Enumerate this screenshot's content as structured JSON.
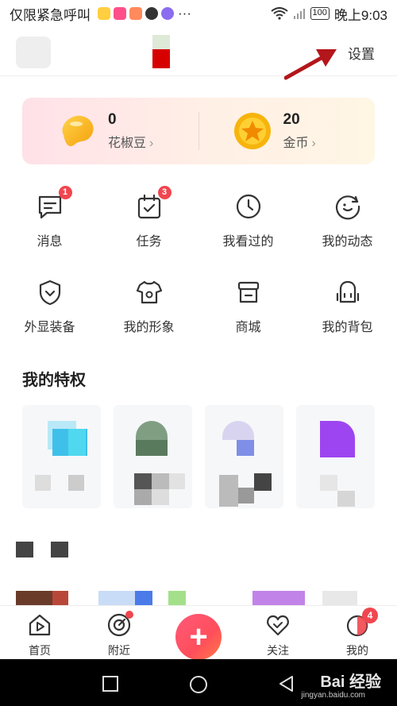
{
  "status_bar": {
    "emergency_text": "仅限紧急呼叫",
    "more": "···",
    "battery": "100",
    "time": "晚上9:03"
  },
  "header": {
    "settings_label": "设置"
  },
  "wallet": {
    "beans": {
      "value": "0",
      "label": "花椒豆"
    },
    "coins": {
      "value": "20",
      "label": "金币"
    }
  },
  "grid": {
    "row1": [
      {
        "label": "消息",
        "badge": "1",
        "icon": "message-icon"
      },
      {
        "label": "任务",
        "badge": "3",
        "icon": "task-icon"
      },
      {
        "label": "我看过的",
        "icon": "clock-icon"
      },
      {
        "label": "我的动态",
        "icon": "activity-icon"
      }
    ],
    "row2": [
      {
        "label": "外显装备",
        "icon": "shield-icon"
      },
      {
        "label": "我的形象",
        "icon": "shirt-icon"
      },
      {
        "label": "商城",
        "icon": "store-icon"
      },
      {
        "label": "我的背包",
        "icon": "backpack-icon"
      }
    ]
  },
  "privileges": {
    "title": "我的特权"
  },
  "tabbar": {
    "home": "首页",
    "nearby": "附近",
    "create": "+",
    "follow": "关注",
    "me": "我的",
    "me_badge": "4"
  },
  "watermark": {
    "brand": "Bai 经验",
    "url": "jingyan.baidu.com"
  },
  "colors": {
    "accent": "#f0464f",
    "fab": "#ff4e5b"
  }
}
